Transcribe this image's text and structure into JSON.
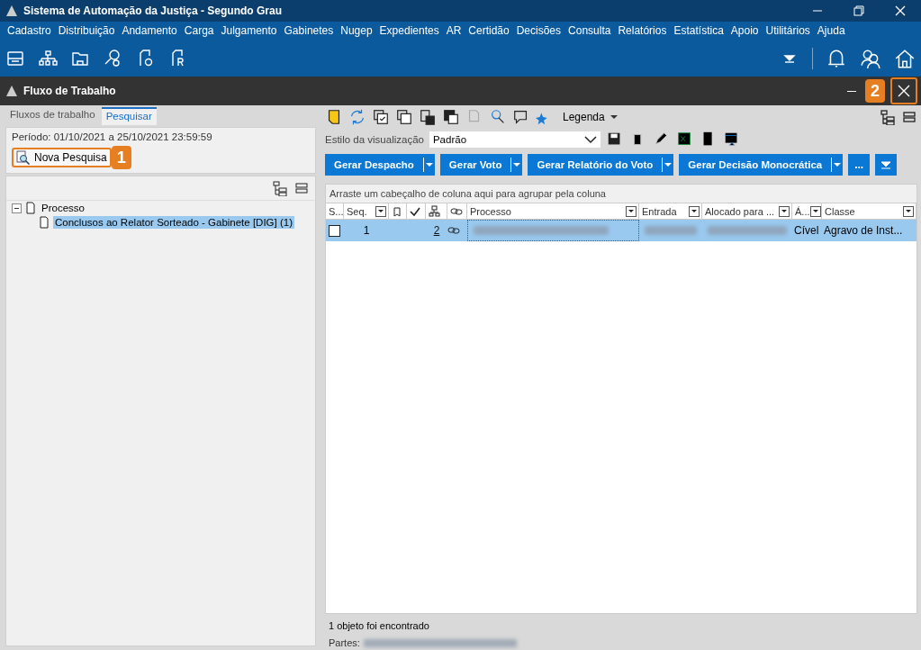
{
  "window": {
    "title": "Sistema de Automação da Justiça - Segundo Grau"
  },
  "menu": [
    "Cadastro",
    "Distribuição",
    "Andamento",
    "Carga",
    "Julgamento",
    "Gabinetes",
    "Nugep",
    "Expedientes",
    "AR",
    "Certidão",
    "Decisões",
    "Consulta",
    "Relatórios",
    "Estatística",
    "Apoio",
    "Utilitários",
    "Ajuda"
  ],
  "subwindow": {
    "title": "Fluxo de Trabalho",
    "callout": "2"
  },
  "left_tabs": [
    {
      "label": "Fluxos de trabalho",
      "selected": false
    },
    {
      "label": "Pesquisar",
      "selected": true
    }
  ],
  "search_panel": {
    "period": "Período: 01/10/2021 a 25/10/2021 23:59:59",
    "new_search_button": "Nova Pesquisa",
    "callout": "1"
  },
  "tree": [
    {
      "label": "Processo",
      "expanded": true,
      "children": [
        {
          "label": "Conclusos ao Relator Sorteado - Gabinete [DIG] (1)",
          "selected": true
        }
      ]
    }
  ],
  "toolbar": {
    "legend": "Legenda"
  },
  "view_style": {
    "label": "Estilo da visualização",
    "value": "Padrão"
  },
  "action_buttons": [
    "Gerar Despacho",
    "Gerar Voto",
    "Gerar Relatório do Voto",
    "Gerar Decisão Monocrática"
  ],
  "more_button": "...",
  "grid": {
    "group_hint": "Arraste um cabeçalho de coluna aqui para agrupar pela coluna",
    "columns": [
      {
        "label": "S..."
      },
      {
        "label": "Seq."
      },
      {
        "label": "Processo"
      },
      {
        "label": "Entrada"
      },
      {
        "label": "Alocado para ..."
      },
      {
        "label": "Á..."
      },
      {
        "label": "Classe"
      }
    ],
    "rows": [
      {
        "selected": true,
        "checked": false,
        "seq": "1",
        "count": "2",
        "area": "Cível",
        "classe": "Agravo de Inst..."
      }
    ]
  },
  "status": {
    "found": "1 objeto foi encontrado",
    "parts_label": "Partes:"
  }
}
